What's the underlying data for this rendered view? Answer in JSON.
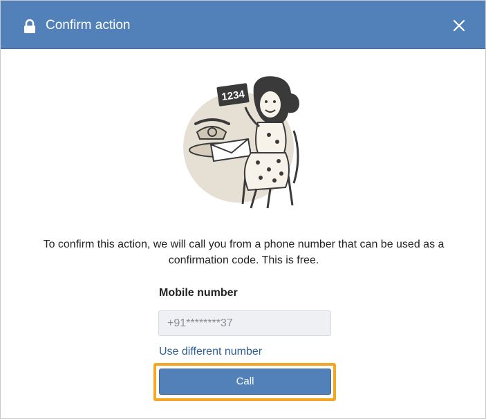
{
  "dialog": {
    "title": "Confirm action",
    "header_icon": "lock-icon",
    "close_icon": "close-icon"
  },
  "message": "To confirm this action, we will call you from a phone number that can be used as a confirmation code. This is free.",
  "illustration": {
    "sign_text": "1234"
  },
  "form": {
    "label": "Mobile number",
    "phone_value": "+91********37",
    "change_link": "Use different number",
    "call_button": "Call"
  },
  "colors": {
    "header": "#5281b9",
    "button": "#5281b9",
    "link": "#2f5f96",
    "highlight": "#f5a623"
  }
}
